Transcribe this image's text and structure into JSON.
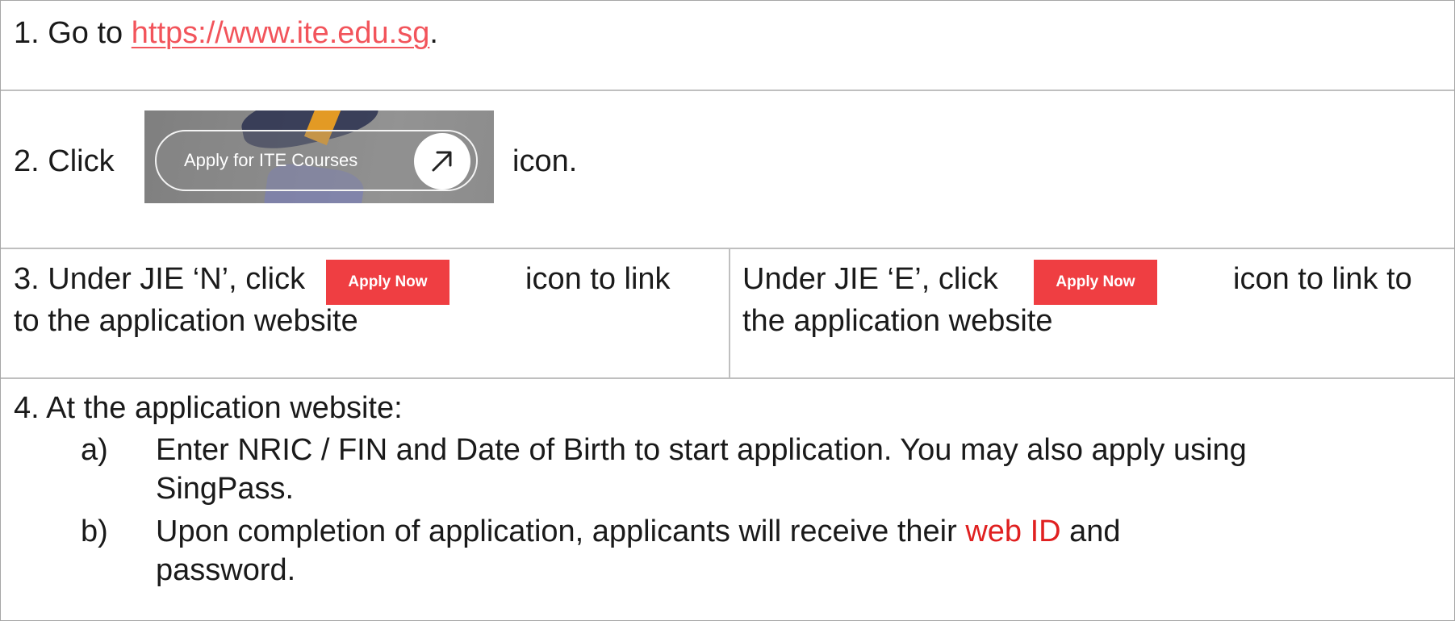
{
  "step1": {
    "prefix": "1.  Go to ",
    "link_text": "https://www.ite.edu.sg",
    "suffix": "."
  },
  "step2": {
    "prefix": "2. Click",
    "button_label": "Apply for ITE Courses",
    "suffix": "icon."
  },
  "step3_left": {
    "text_a": "3. Under JIE ‘N’, click",
    "button_label": "Apply Now",
    "text_b": "icon to link",
    "text_c": "to the application website"
  },
  "step3_right": {
    "text_a": "Under JIE ‘E’, click",
    "button_label": "Apply Now",
    "text_b": "icon to link to",
    "text_c": "the application website"
  },
  "step4": {
    "intro": "4. At the application website:",
    "item_a": {
      "marker": "a)",
      "line1": "Enter NRIC / FIN and Date of Birth to start application. You may also apply using",
      "line2": "SingPass."
    },
    "item_b": {
      "marker": "b)",
      "line1_before": "Upon completion of application, applicants will receive their ",
      "highlight": "web ID",
      "line1_after": " and",
      "line2": "password."
    }
  },
  "colors": {
    "link": "#f2545b",
    "apply_button": "#ef3e42",
    "highlight": "#e02020",
    "border": "#bfbfbf"
  },
  "icons": {
    "arrow": "arrow-up-right-icon"
  }
}
